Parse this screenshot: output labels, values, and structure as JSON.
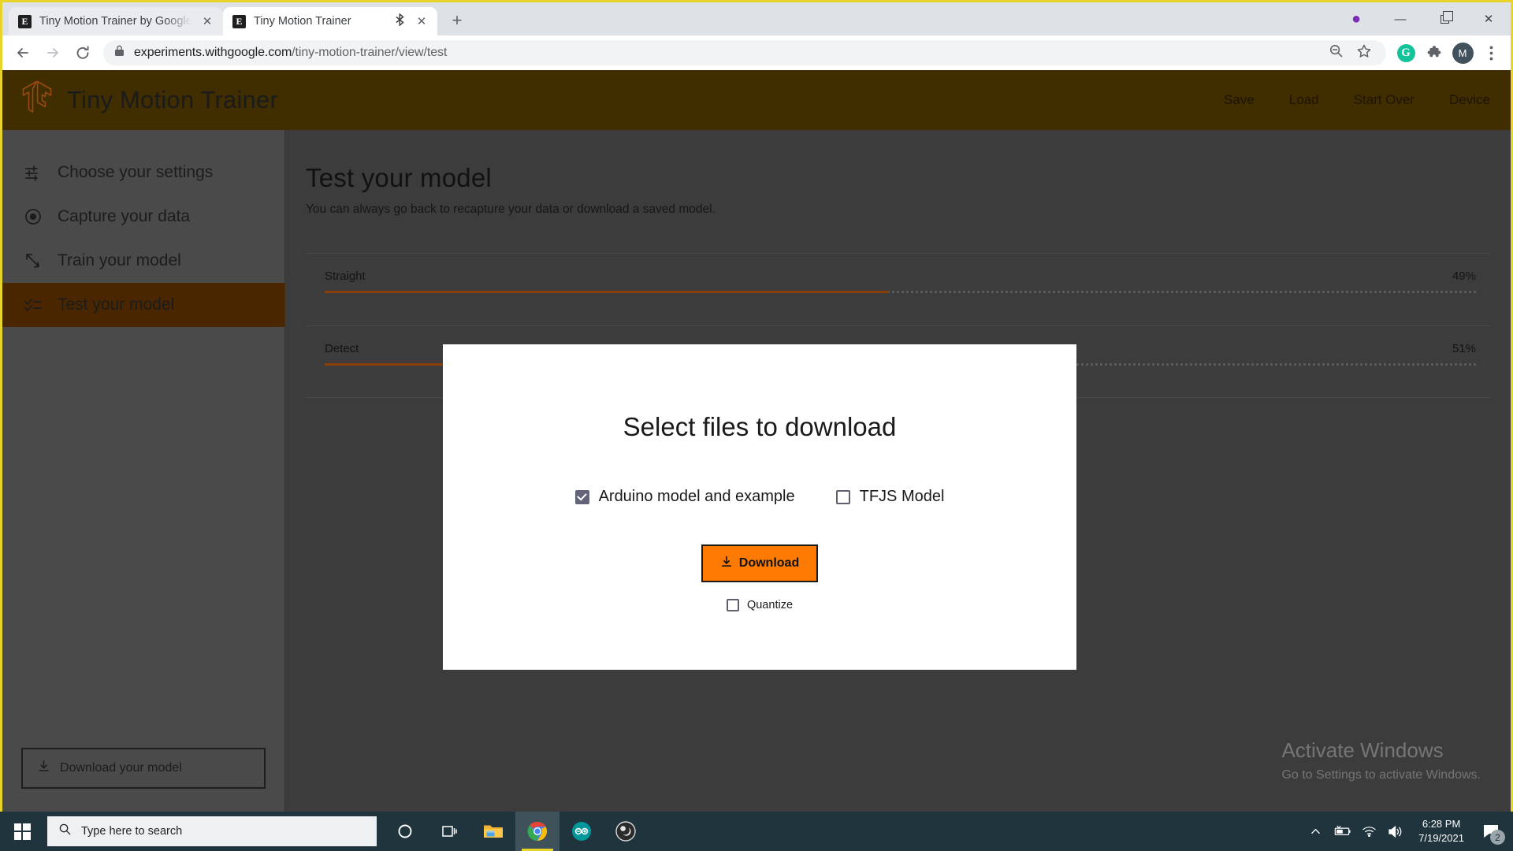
{
  "browser": {
    "tabs": [
      {
        "favicon": "E",
        "title": "Tiny Motion Trainer by Google C",
        "active": false,
        "bluetooth": false
      },
      {
        "favicon": "E",
        "title": "Tiny Motion Trainer",
        "active": true,
        "bluetooth": true
      }
    ],
    "new_tab_label": "+",
    "window_controls": {
      "minimize": "—",
      "restore": "restore",
      "close": "✕"
    },
    "url_domain": "experiments.withgoogle.com",
    "url_path": "/tiny-motion-trainer/view/test",
    "avatar_letter": "M",
    "grammarly_letter": "G"
  },
  "app": {
    "title": "Tiny Motion Trainer",
    "nav": [
      "Save",
      "Load",
      "Start Over",
      "Device"
    ],
    "header_bg": "#402d00"
  },
  "sidebar": {
    "items": [
      {
        "label": "Choose your settings",
        "icon": "sliders-icon",
        "active": false
      },
      {
        "label": "Capture your data",
        "icon": "record-icon",
        "active": false
      },
      {
        "label": "Train your model",
        "icon": "train-icon",
        "active": false
      },
      {
        "label": "Test your model",
        "icon": "checklist-icon",
        "active": true
      }
    ],
    "download_model_button": "Download your model",
    "active_bg": "#4a2600"
  },
  "main": {
    "title": "Test your model",
    "subtitle": "You can always go back to recapture your data or download a saved model."
  },
  "chart_data": {
    "type": "bar",
    "title": "",
    "categories": [
      "Straight",
      "Detect"
    ],
    "values": [
      49,
      51
    ],
    "value_labels": [
      "49%",
      "51%"
    ],
    "xlabel": "",
    "ylabel": "",
    "ylim": [
      0,
      100
    ],
    "bar_color": "#8a3f06",
    "track_color": "#5a5a5a",
    "orientation": "horizontal"
  },
  "modal": {
    "title": "Select files to download",
    "checkboxes": [
      {
        "label": "Arduino model and example",
        "checked": true
      },
      {
        "label": "TFJS Model",
        "checked": false
      }
    ],
    "download_button": "Download",
    "download_button_color": "#ff7a00",
    "quantize": {
      "label": "Quantize",
      "checked": false
    }
  },
  "watermark": {
    "line1": "Activate Windows",
    "line2": "Go to Settings to activate Windows."
  },
  "taskbar": {
    "search_placeholder": "Type here to search",
    "time": "6:28 PM",
    "date": "7/19/2021",
    "notification_count": "2"
  }
}
